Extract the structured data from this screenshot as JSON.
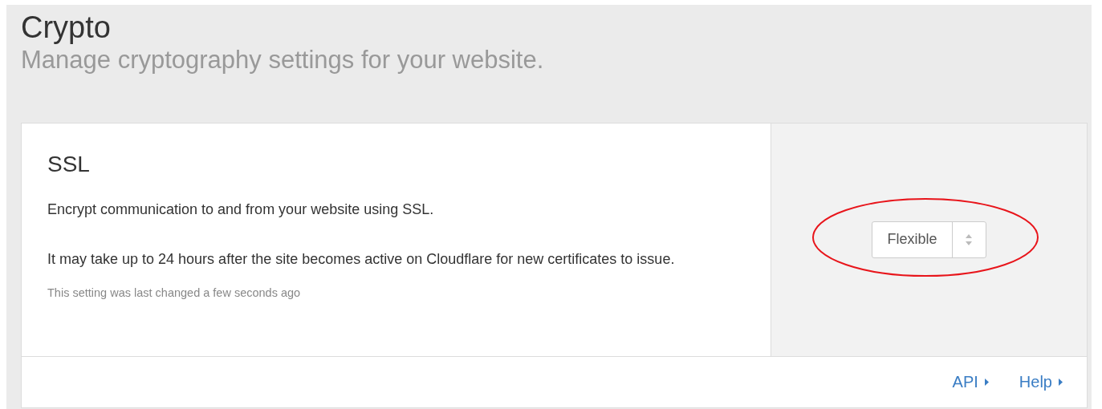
{
  "page": {
    "title": "Crypto",
    "subtitle": "Manage cryptography settings for your website."
  },
  "setting": {
    "title": "SSL",
    "paragraphs": [
      "Encrypt communication to and from your website using SSL.",
      "It may take up to 24 hours after the site becomes active on Cloudflare for new certificates to issue."
    ],
    "last_changed": "This setting was last changed a few seconds ago",
    "select": {
      "value": "Flexible",
      "highlighted": true
    },
    "links": [
      "API",
      "Help"
    ]
  }
}
